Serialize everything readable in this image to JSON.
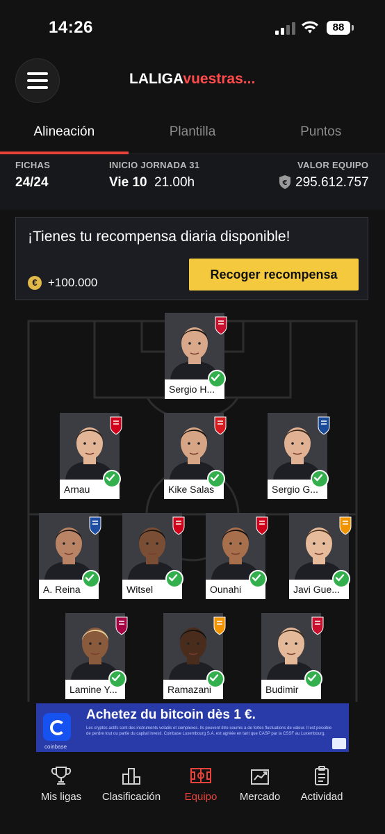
{
  "status_bar": {
    "time": "14:26",
    "battery": "88"
  },
  "header": {
    "brand_part1": "LALIGA",
    "brand_part2": "vuestras..."
  },
  "tabs": [
    {
      "label": "Alineación",
      "active": true
    },
    {
      "label": "Plantilla",
      "active": false
    },
    {
      "label": "Puntos",
      "active": false
    }
  ],
  "info": {
    "fichas_label": "FICHAS",
    "fichas_value": "24/24",
    "jornada_label": "INICIO JORNADA 31",
    "jornada_day": "Vie 10",
    "jornada_time": "21.00h",
    "valor_label": "VALOR EQUIPO",
    "valor_value": "295.612.757"
  },
  "reward": {
    "message": "¡Tienes tu recompensa diaria disponible!",
    "coin_symbol": "€",
    "amount": "+100.000",
    "button_label": "Recoger recompensa"
  },
  "lineup": [
    {
      "name": "Sergio H...",
      "badge_color": "#c8102e"
    },
    {
      "name": "Arnau",
      "badge_color": "#d0021b"
    },
    {
      "name": "Kike Salas",
      "badge_color": "#d71920"
    },
    {
      "name": "Sergio G...",
      "badge_color": "#1a4a9a"
    },
    {
      "name": "A. Reina",
      "badge_color": "#1e4fa3"
    },
    {
      "name": "Witsel",
      "badge_color": "#d0021b"
    },
    {
      "name": "Ounahi",
      "badge_color": "#d0021b"
    },
    {
      "name": "Javi Gue...",
      "badge_color": "#f29400"
    },
    {
      "name": "Lamine Y...",
      "badge_color": "#a50044"
    },
    {
      "name": "Ramazani",
      "badge_color": "#f29400"
    },
    {
      "name": "Budimir",
      "badge_color": "#c8102e"
    }
  ],
  "ad": {
    "headline": "Achetez du bitcoin dès 1 €.",
    "brand": "coinbase",
    "fine_print": "Les cryptos actifs sont des instruments volatils et complexes. Ils peuvent être soumis à de fortes fluctuations de valeur. Il est possible de perdre tout ou partie du capital investi. Coinbase Luxembourg S.A. est agréée en tant que CASP par la CSSF au Luxembourg."
  },
  "nav": [
    {
      "label": "Mis ligas",
      "icon": "trophy-icon",
      "active": false
    },
    {
      "label": "Clasificación",
      "icon": "podium-icon",
      "active": false
    },
    {
      "label": "Equipo",
      "icon": "pitch-icon",
      "active": true
    },
    {
      "label": "Mercado",
      "icon": "market-icon",
      "active": false
    },
    {
      "label": "Actividad",
      "icon": "clipboard-icon",
      "active": false
    }
  ],
  "colors": {
    "accent": "#e8433a",
    "button": "#f4c93d",
    "check": "#33b04d",
    "background": "#121212"
  }
}
